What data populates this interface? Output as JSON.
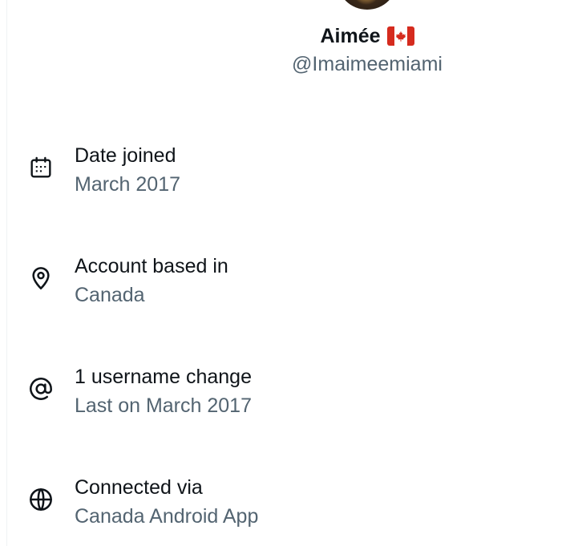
{
  "profile": {
    "display_name": "Aimée",
    "flag_icon": "canada-flag-icon",
    "handle": "@Imaimeemiami"
  },
  "info": {
    "items": [
      {
        "icon": "calendar-icon",
        "title": "Date joined",
        "value": "March 2017"
      },
      {
        "icon": "location-pin-icon",
        "title": "Account based in",
        "value": "Canada"
      },
      {
        "icon": "at-sign-icon",
        "title": "1 username change",
        "value": "Last on March 2017"
      },
      {
        "icon": "globe-icon",
        "title": "Connected via",
        "value": "Canada Android App"
      }
    ]
  },
  "colors": {
    "primary_text": "#0f1419",
    "secondary_text": "#536471",
    "flag_red": "#d52b1e"
  }
}
